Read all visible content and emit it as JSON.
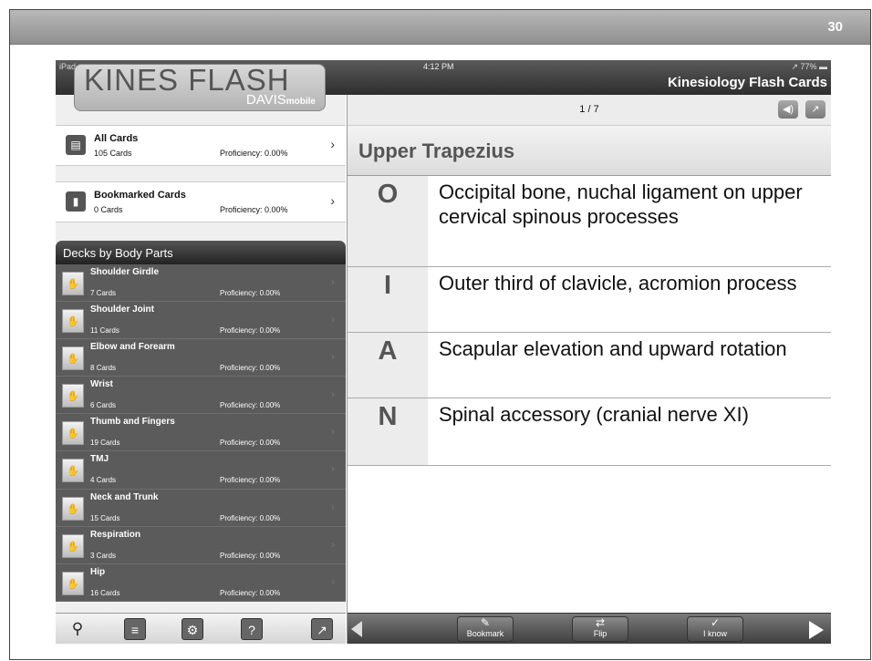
{
  "slide": {
    "number": "30"
  },
  "status": {
    "carrier": "iPad ≈",
    "time": "4:12 PM",
    "battery": "↗ 77% ▬"
  },
  "app": {
    "title": "Kinesiology Flash Cards",
    "logo_main": "KINES FLASH",
    "logo_sub": "DAVIS",
    "logo_sub_small": "mobile"
  },
  "sidebar": {
    "all_cards": {
      "title": "All Cards",
      "count": "105 Cards",
      "proficiency": "Proficiency: 0.00%"
    },
    "bookmarked": {
      "title": "Bookmarked Cards",
      "count": "0 Cards",
      "proficiency": "Proficiency: 0.00%"
    },
    "decks_header": "Decks by Body Parts",
    "decks": [
      {
        "title": "Shoulder Girdle",
        "count": "7 Cards",
        "proficiency": "Proficiency: 0.00%"
      },
      {
        "title": "Shoulder Joint",
        "count": "11 Cards",
        "proficiency": "Proficiency: 0.00%"
      },
      {
        "title": "Elbow and Forearm",
        "count": "8 Cards",
        "proficiency": "Proficiency: 0.00%"
      },
      {
        "title": "Wrist",
        "count": "6 Cards",
        "proficiency": "Proficiency: 0.00%"
      },
      {
        "title": "Thumb and Fingers",
        "count": "19 Cards",
        "proficiency": "Proficiency: 0.00%"
      },
      {
        "title": "TMJ",
        "count": "4 Cards",
        "proficiency": "Proficiency: 0.00%"
      },
      {
        "title": "Neck and Trunk",
        "count": "15 Cards",
        "proficiency": "Proficiency: 0.00%"
      },
      {
        "title": "Respiration",
        "count": "3 Cards",
        "proficiency": "Proficiency: 0.00%"
      },
      {
        "title": "Hip",
        "count": "16 Cards",
        "proficiency": "Proficiency: 0.00%"
      }
    ],
    "toolbar": [
      "search-icon",
      "list-icon",
      "settings-icon",
      "help-icon",
      "share-icon"
    ],
    "help_label": "?"
  },
  "card": {
    "counter": "1 / 7",
    "term": "Upper Trapezius",
    "rows": [
      {
        "letter": "O",
        "text": "Occipital bone, nuchal ligament on upper cervical spinous processes"
      },
      {
        "letter": "I",
        "text": "Outer third of clavicle, acromion process"
      },
      {
        "letter": "A",
        "text": "Scapular elevation and upward rotation"
      },
      {
        "letter": "N",
        "text": "Spinal accessory (cranial nerve XI)"
      }
    ]
  },
  "bottom_bar": {
    "bookmark_label": "Bookmark",
    "flip_label": "Flip",
    "iknow_label": "I know"
  }
}
